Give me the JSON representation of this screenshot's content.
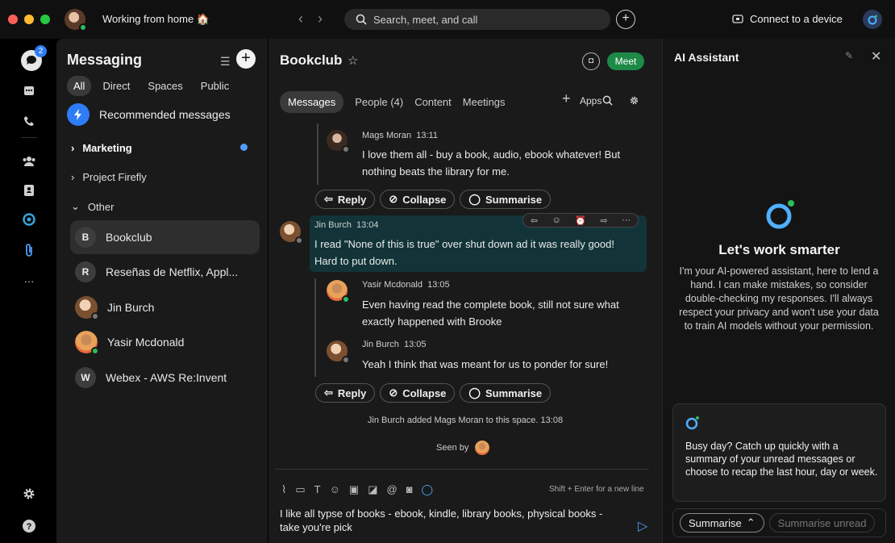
{
  "topbar": {
    "status_text": "Working from home 🏠",
    "search_placeholder": "Search, meet, and call",
    "connect_label": "Connect to a device"
  },
  "rail": {
    "messaging_badge": "2",
    "more_label": "···"
  },
  "messaging": {
    "title": "Messaging",
    "tabs": [
      "All",
      "Direct",
      "Spaces",
      "Public"
    ],
    "recommended": "Recommended messages",
    "groups": [
      {
        "label": "Marketing",
        "unread": true
      },
      {
        "label": "Project Firefly",
        "unread": false
      },
      {
        "label": "Other",
        "unread": false
      }
    ],
    "conversations": [
      {
        "initial": "B",
        "name": "Bookclub",
        "selected": true
      },
      {
        "initial": "R",
        "name": "Reseñas de Netflix, Appl..."
      },
      {
        "initial": "",
        "name": "Jin Burch"
      },
      {
        "initial": "",
        "name": "Yasir Mcdonald"
      },
      {
        "initial": "W",
        "name": "Webex - AWS Re:Invent"
      }
    ]
  },
  "chat": {
    "title": "Bookclub",
    "meet_label": "Meet",
    "tabs": [
      "Messages",
      "People (4)",
      "Content",
      "Meetings"
    ],
    "apps_label": "Apps",
    "messages": [
      {
        "author": "Mags Moran",
        "time": "13:11",
        "text": "I love them all - buy a book, audio, ebook whatever! But nothing beats the library for me."
      },
      {
        "author": "Jin Burch",
        "time": "13:04",
        "text": "I read \"None of this is true\" over shut down ad it was really good! Hard to put down."
      },
      {
        "author": "Yasir Mcdonald",
        "time": "13:05",
        "text": "Even having read the complete book, still not sure what exactly happened with Brooke"
      },
      {
        "author": "Jin Burch",
        "time": "13:05",
        "text": "Yeah I think that was meant for us to ponder for sure!"
      }
    ],
    "actions": {
      "reply": "Reply",
      "collapse": "Collapse",
      "summarise": "Summarise"
    },
    "system_message": "Jin Burch added Mags Moran to this space. 13:08",
    "seen_by": "Seen by",
    "composer_hint": "Shift + Enter for a new line",
    "composer_text": "I like all typse of books - ebook, kindle, library books, physical books - take you're pick"
  },
  "ai": {
    "title": "AI Assistant",
    "headline": "Let's work smarter",
    "intro": "I'm your AI-powered assistant, here to lend a hand. I can make mistakes, so consider double-checking my responses. I'll always respect your privacy and won't use your data to train AI models without your permission.",
    "card_text": "Busy day? Catch up quickly with a summary of your unread messages or choose to recap the last hour, day or week.",
    "summarise_label": "Summarise",
    "summarise_unread_label": "Summarise unread"
  },
  "colors": {
    "accent": "#2e7cf6",
    "meet": "#1d8a47",
    "highlight": "#123438"
  }
}
